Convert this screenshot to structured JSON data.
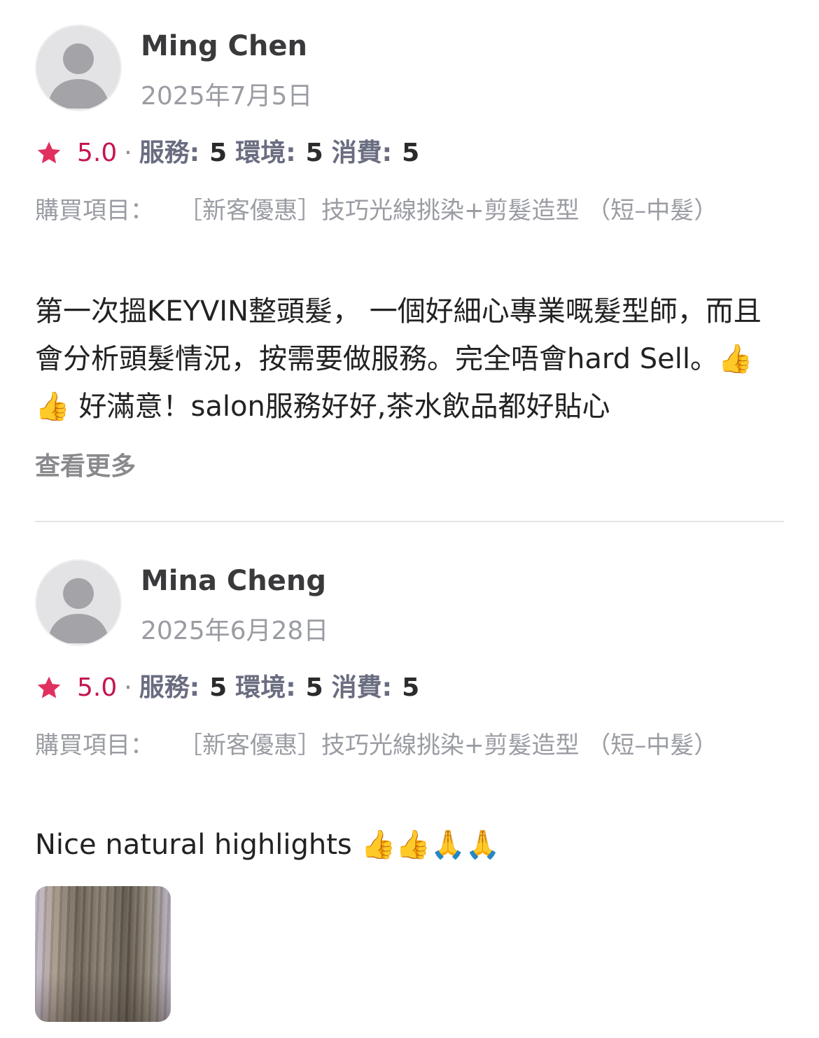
{
  "reviews": [
    {
      "name": "Ming Chen",
      "date": "2025年7月5日",
      "score": "5.0",
      "dot": "·",
      "service_label": "服務:",
      "service_value": "5",
      "environment_label": "環境:",
      "environment_value": "5",
      "price_label": "消費:",
      "price_value": "5",
      "purchase_label": "購買項目：",
      "purchase_item": "［新客優惠］技巧光線挑染+剪髮造型 （短–中髮）",
      "text": "第一次搵KEYVIN整頭髮， 一個好細心專業嘅髮型師，而且會分析頭髮情況，按需要做服務。完全唔會hard Sell。👍👍 好滿意！salon服務好好,茶水飲品都好貼心",
      "more_label": "查看更多"
    },
    {
      "name": "Mina Cheng",
      "date": "2025年6月28日",
      "score": "5.0",
      "dot": "·",
      "service_label": "服務:",
      "service_value": "5",
      "environment_label": "環境:",
      "environment_value": "5",
      "price_label": "消費:",
      "price_value": "5",
      "purchase_label": "購買項目：",
      "purchase_item": "［新客優惠］技巧光線挑染+剪髮造型 （短–中髮）",
      "text": "Nice natural highlights 👍👍🙏🙏"
    }
  ],
  "colors": {
    "star": "#e0305e",
    "score": "#c4164f",
    "meta": "#9a9ca3"
  },
  "icons": {
    "avatar": "default-user-avatar-icon",
    "star": "star-icon"
  }
}
